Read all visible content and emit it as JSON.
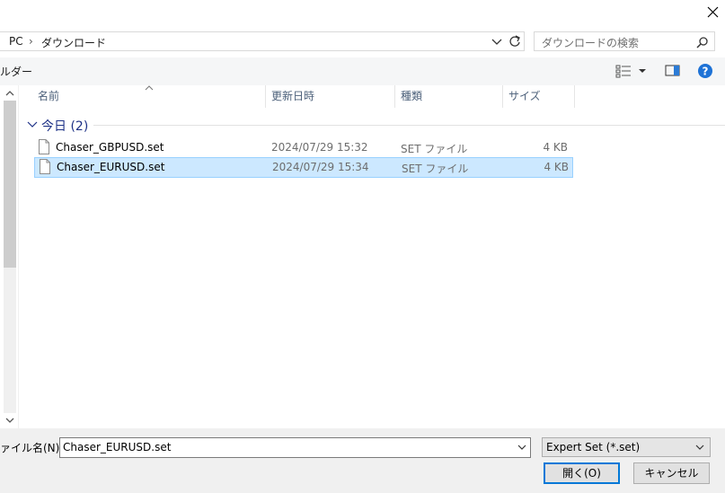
{
  "window": {
    "close_label": "✕"
  },
  "address": {
    "crumbs": [
      "PC",
      "ダウンロード"
    ],
    "separator": "›"
  },
  "search": {
    "placeholder": "ダウンロードの検索"
  },
  "toolbar": {
    "folder_label": "ルダー"
  },
  "columns": {
    "name": "名前",
    "date": "更新日時",
    "type": "種類",
    "size": "サイズ"
  },
  "group": {
    "label": "今日 (2)"
  },
  "files": [
    {
      "name": "Chaser_GBPUSD.set",
      "date": "2024/07/29 15:32",
      "type": "SET ファイル",
      "size": "4 KB",
      "selected": false
    },
    {
      "name": "Chaser_EURUSD.set",
      "date": "2024/07/29 15:34",
      "type": "SET ファイル",
      "size": "4 KB",
      "selected": true
    }
  ],
  "footer": {
    "filename_label": "ァイル名(N):",
    "filename_value": "Chaser_EURUSD.set",
    "filetype_value": "Expert Set (*.set)",
    "open_label": "開く(O)",
    "cancel_label": "キャンセル"
  },
  "colors": {
    "selection": "#cce8ff",
    "selection_border": "#99d1ff",
    "accent": "#0078d7",
    "group_text": "#1e3287"
  }
}
